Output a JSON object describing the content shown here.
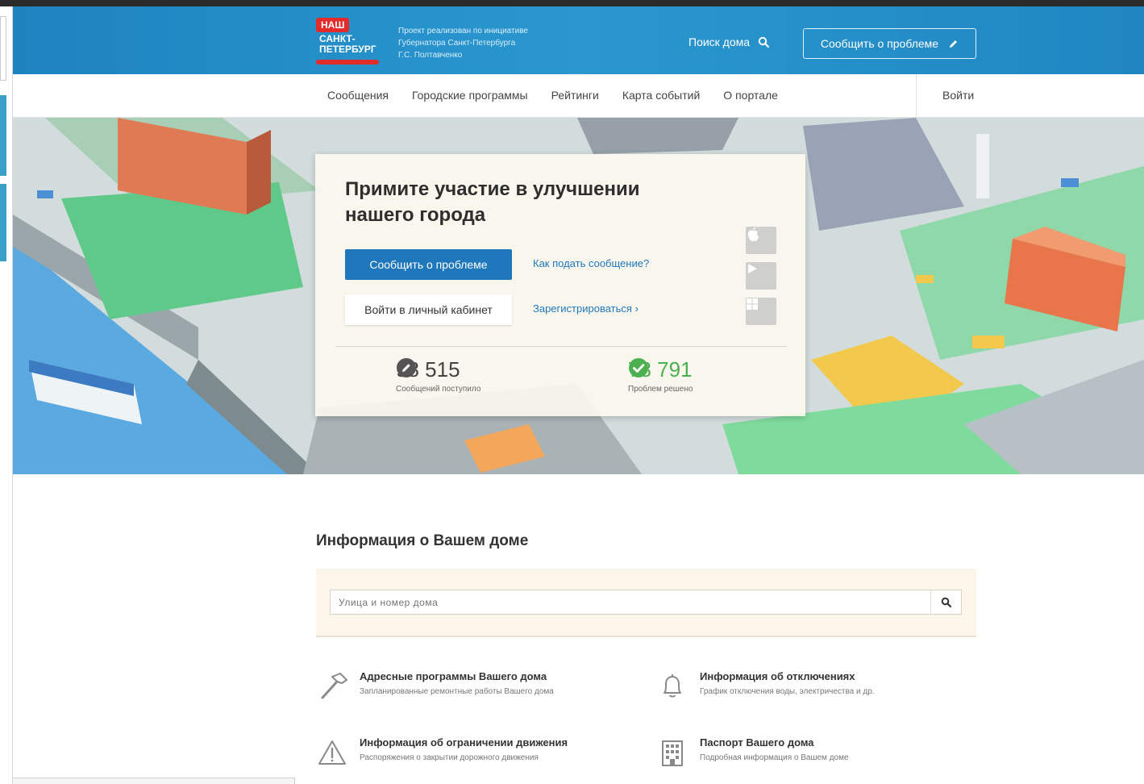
{
  "header": {
    "logo": {
      "badge": "НАШ",
      "line1": "САНКТ-",
      "line2": "ПЕТЕРБУРГ"
    },
    "tagline": [
      "Проект реализован по инициативе",
      "Губернатора Санкт-Петербурга",
      "Г.С. Полтавченко"
    ],
    "search_label": "Поиск дома",
    "report_label": "Сообщить о проблеме"
  },
  "nav": {
    "items": [
      "Сообщения",
      "Городские программы",
      "Рейтинги",
      "Карта событий",
      "О портале"
    ],
    "login": "Войти"
  },
  "hero": {
    "title": "Примите участие в улучшении нашего города",
    "primary_button": "Сообщить о проблеме",
    "secondary_button": "Войти в личный кабинет",
    "how_link": "Как подать сообщение?",
    "register_link": "Зарегистрироваться",
    "stores": [
      "apple-icon",
      "play-icon",
      "windows-icon"
    ],
    "stats": [
      {
        "value": "98 515",
        "caption": "Сообщений поступило"
      },
      {
        "value": "78 791",
        "caption": "Проблем решено"
      }
    ]
  },
  "info": {
    "title": "Информация о Вашем доме",
    "search_placeholder": "Улица и номер дома",
    "features": [
      {
        "title": "Адресные программы Вашего дома",
        "desc": "Запланированные ремонтные работы Вашего дома",
        "icon": "hammer-icon"
      },
      {
        "title": "Информация об отключениях",
        "desc": "График отключения воды, электричества и др.",
        "icon": "bell-icon"
      },
      {
        "title": "Информация об ограничении движения",
        "desc": "Распоряжения о закрытии дорожного движения",
        "icon": "warning-icon"
      },
      {
        "title": "Паспорт Вашего дома",
        "desc": "Подробная информация о Вашем доме",
        "icon": "building-icon"
      }
    ]
  },
  "colors": {
    "header_blue": "#1d83c0",
    "primary": "#1f78bc",
    "success": "#4caf50",
    "logo_red": "#e32b2b"
  }
}
